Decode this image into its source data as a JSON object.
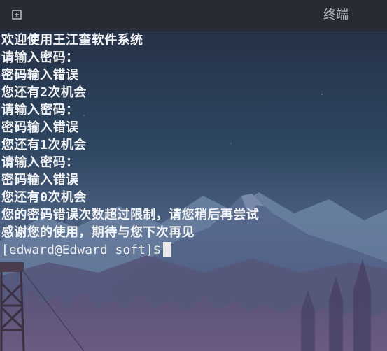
{
  "window": {
    "title": "终端",
    "new_tab_icon": "new-tab-icon"
  },
  "terminal": {
    "lines": [
      "欢迎使用王江奎软件系统",
      "请输入密码：",
      "密码输入错误",
      "您还有2次机会",
      "请输入密码：",
      "密码输入错误",
      "您还有1次机会",
      "请输入密码：",
      "密码输入错误",
      "您还有0次机会",
      "您的密码错误次数超过限制，请您稍后再尝试",
      "感谢您的使用，期待与您下次再见"
    ],
    "prompt": "[edward@Edward soft]$"
  },
  "colors": {
    "titlebar": "#272b33",
    "text": "#f2f3f5",
    "cursor": "#e8e8ea",
    "sky_top": "#2f3f5a",
    "sky_bottom": "#5a6a8a"
  }
}
